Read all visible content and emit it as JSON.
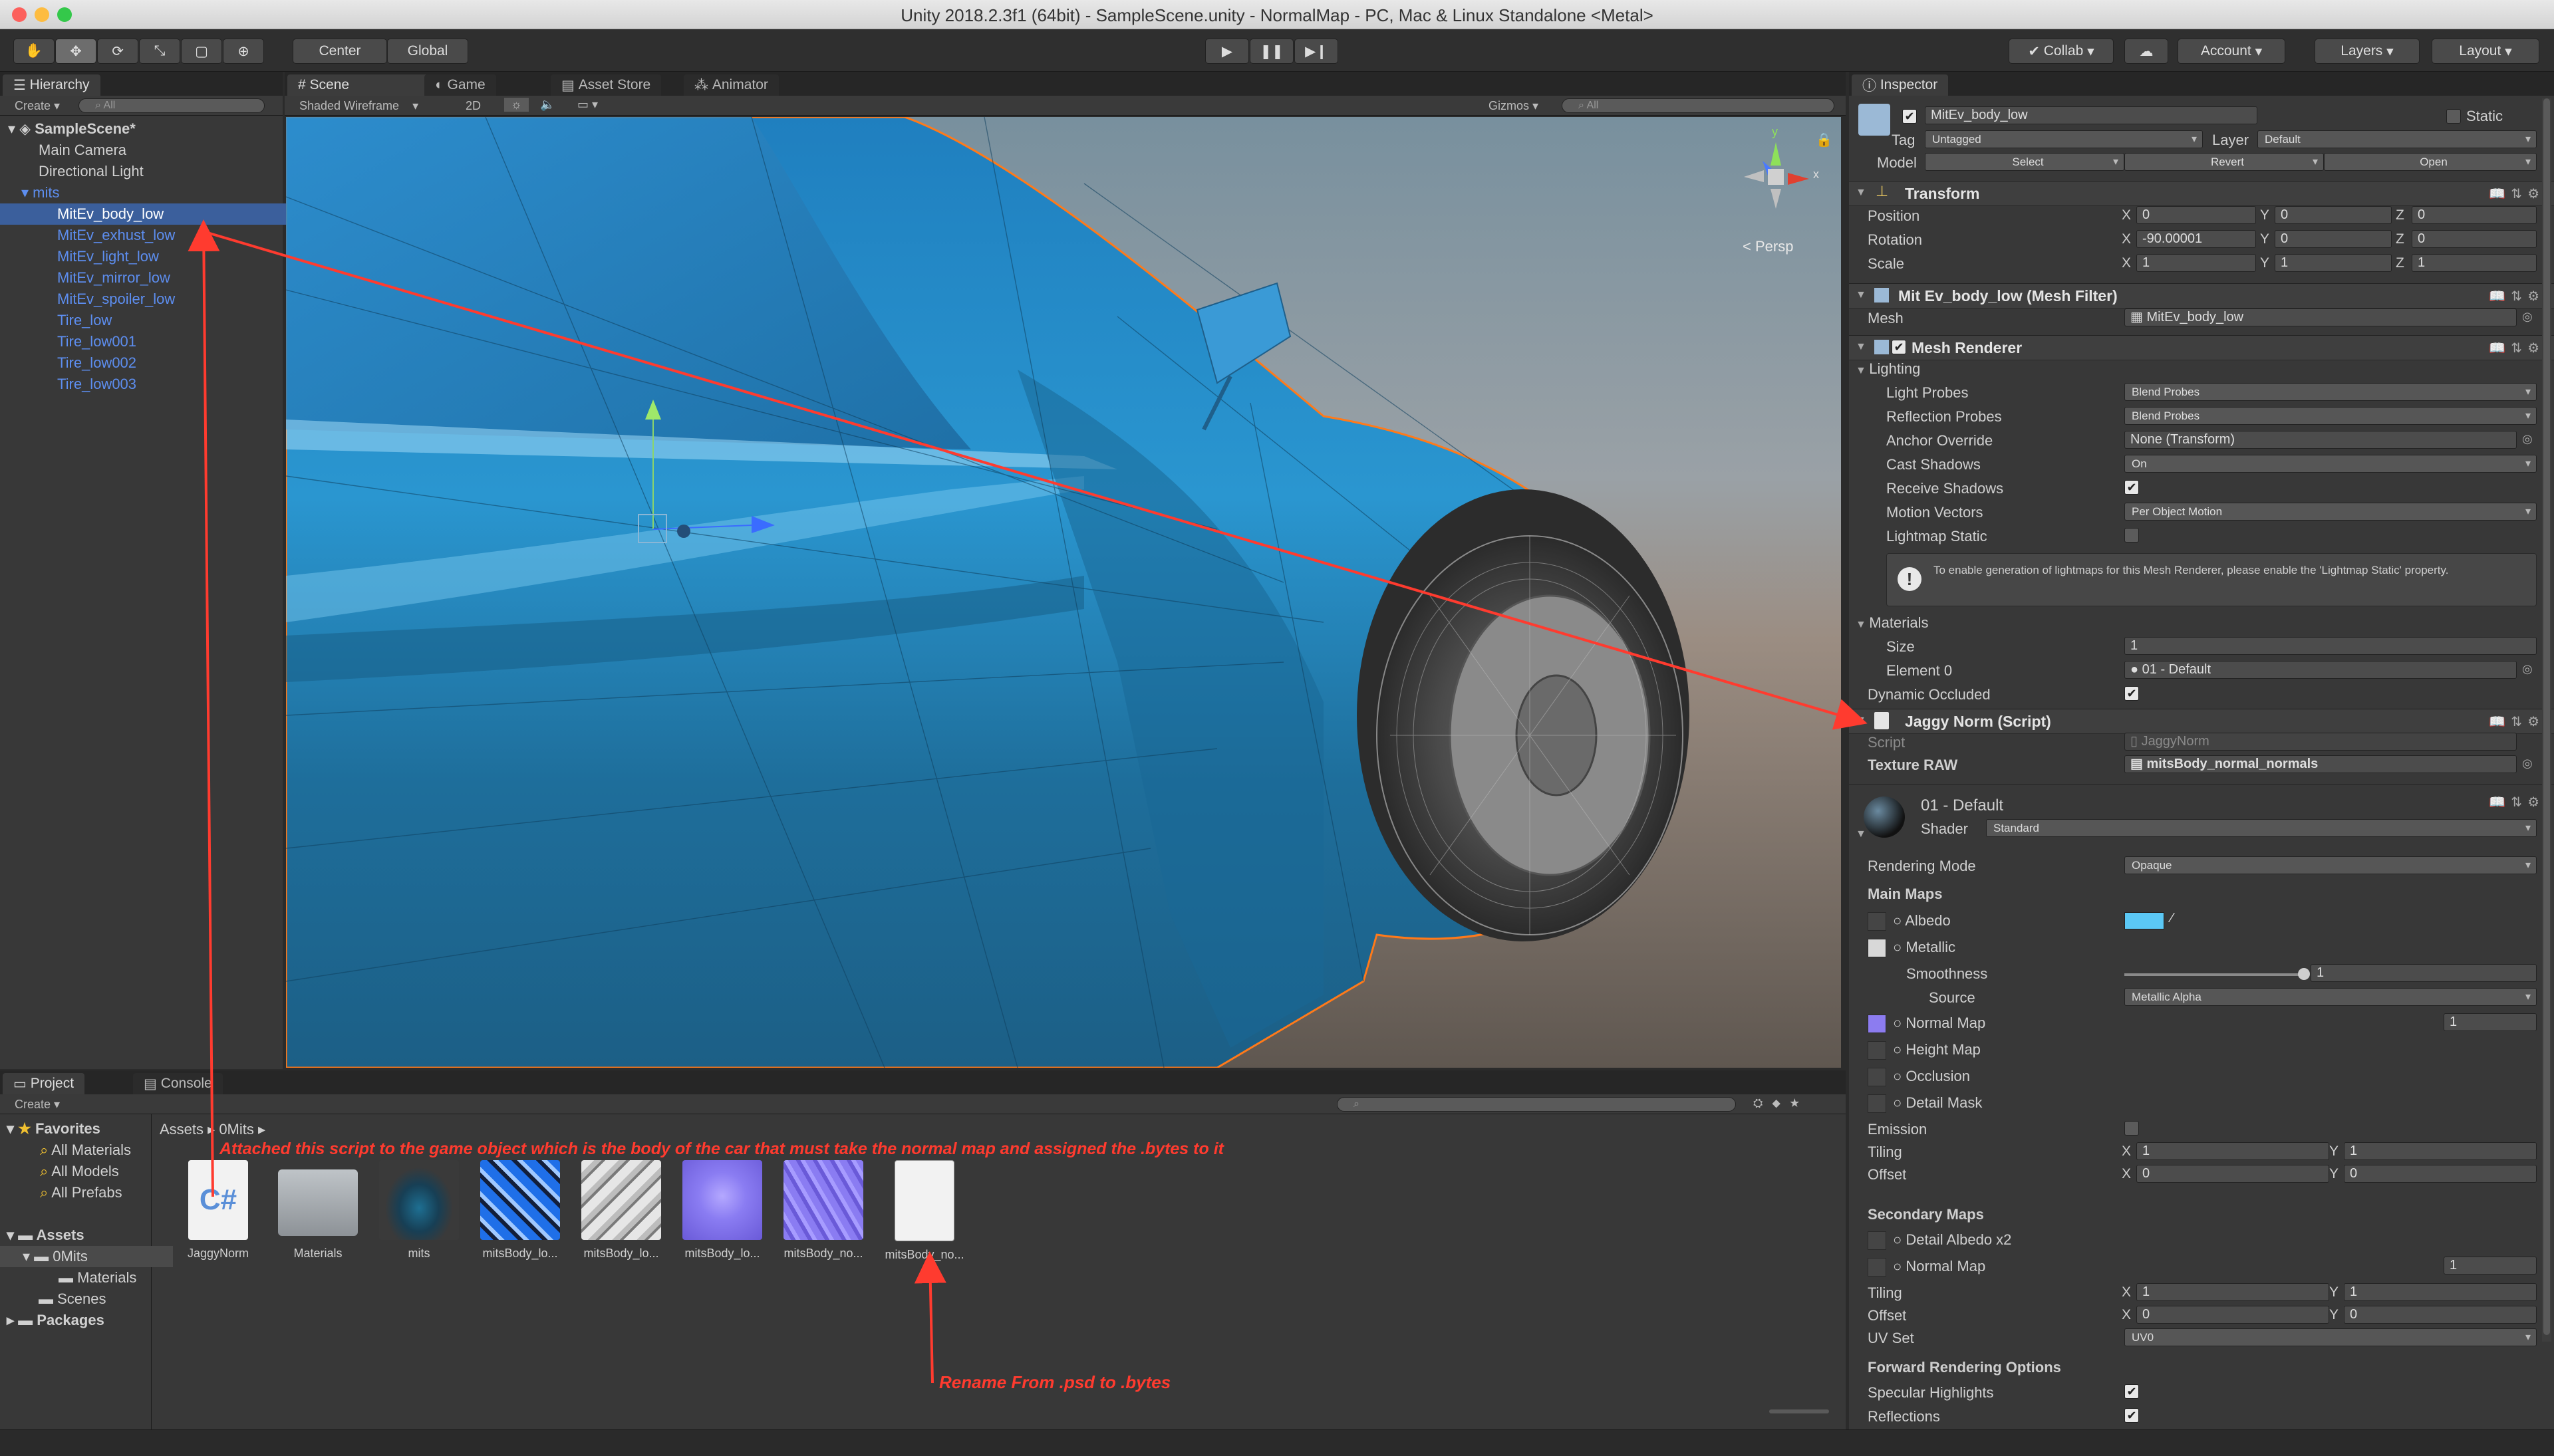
{
  "window": {
    "title": "Unity 2018.2.3f1 (64bit) - SampleScene.unity - NormalMap - PC, Mac & Linux Standalone <Metal>"
  },
  "toolbar": {
    "center": "Center",
    "global": "Global",
    "collab": "Collab",
    "account": "Account",
    "layers": "Layers",
    "layout": "Layout"
  },
  "hierarchy": {
    "tab": "Hierarchy",
    "create": "Create",
    "search_placeholder": "All",
    "items": [
      "SampleScene*",
      "Main Camera",
      "Directional Light",
      "mits",
      "MitEv_body_low",
      "MitEv_exhust_low",
      "MitEv_light_low",
      "MitEv_mirror_low",
      "MitEv_spoiler_low",
      "Tire_low",
      "Tire_low001",
      "Tire_low002",
      "Tire_low003"
    ]
  },
  "scene": {
    "tabs": [
      "Scene",
      "Game",
      "Asset Store",
      "Animator"
    ],
    "shading": "Shaded Wireframe",
    "mode2d": "2D",
    "gizmos": "Gizmos",
    "search_placeholder": "All",
    "persp": "Persp",
    "gizmo_axes": {
      "y": "y",
      "x": "x"
    }
  },
  "inspector": {
    "tab": "Inspector",
    "object_name": "MitEv_body_low",
    "static": "Static",
    "tag_label": "Tag",
    "tag": "Untagged",
    "layer_label": "Layer",
    "layer": "Default",
    "model_label": "Model",
    "model_select": "Select",
    "model_revert": "Revert",
    "model_open": "Open",
    "transform": {
      "title": "Transform",
      "position": "Position",
      "rotation": "Rotation",
      "scale": "Scale",
      "pos": [
        "0",
        "0",
        "0"
      ],
      "rot": [
        "-90.00001",
        "0",
        "0"
      ],
      "scl": [
        "1",
        "1",
        "1"
      ]
    },
    "mesh_filter": {
      "title": "Mit Ev_body_low (Mesh Filter)",
      "mesh_label": "Mesh",
      "mesh": "MitEv_body_low"
    },
    "mesh_renderer": {
      "title": "Mesh Renderer",
      "lighting": "Lighting",
      "light_probes": "Light Probes",
      "light_probes_val": "Blend Probes",
      "reflection_probes": "Reflection Probes",
      "reflection_probes_val": "Blend Probes",
      "anchor_override": "Anchor Override",
      "anchor_override_val": "None (Transform)",
      "cast_shadows": "Cast Shadows",
      "cast_shadows_val": "On",
      "receive_shadows": "Receive Shadows",
      "motion_vectors": "Motion Vectors",
      "motion_vectors_val": "Per Object Motion",
      "lightmap_static": "Lightmap Static",
      "info": "To enable generation of lightmaps for this Mesh Renderer, please enable the 'Lightmap Static' property.",
      "materials": "Materials",
      "size": "Size",
      "size_val": "1",
      "element0": "Element 0",
      "element0_val": "01 - Default",
      "dynamic_occluded": "Dynamic Occluded"
    },
    "script": {
      "title": "Jaggy Norm (Script)",
      "script_label": "Script",
      "script_val": "JaggyNorm",
      "texture_raw": "Texture RAW",
      "texture_raw_val": "mitsBody_normal_normals"
    },
    "material": {
      "name": "01 - Default",
      "shader_label": "Shader",
      "shader": "Standard",
      "rendering_mode": "Rendering Mode",
      "rendering_mode_val": "Opaque",
      "main_maps": "Main Maps",
      "albedo": "Albedo",
      "metallic": "Metallic",
      "smoothness": "Smoothness",
      "smoothness_val": "1",
      "smoothness_level": 1,
      "source": "Source",
      "source_val": "Metallic Alpha",
      "normal_map": "Normal Map",
      "normal_val": "1",
      "height_map": "Height Map",
      "occlusion": "Occlusion",
      "detail_mask": "Detail Mask",
      "emission": "Emission",
      "tiling": "Tiling",
      "offset": "Offset",
      "tiling_x": "1",
      "tiling_y": "1",
      "offset_x": "0",
      "offset_y": "0",
      "secondary_maps": "Secondary Maps",
      "detail_albedo": "Detail Albedo x2",
      "normal_map2": "Normal Map",
      "normal2_val": "1",
      "tiling2_x": "1",
      "tiling2_y": "1",
      "offset2_x": "0",
      "offset2_y": "0",
      "uv_set": "UV Set",
      "uv_set_val": "UV0",
      "forward_options": "Forward Rendering Options",
      "specular_highlights": "Specular Highlights",
      "reflections": "Reflections",
      "albedo_color": "#5bc8f5"
    }
  },
  "project": {
    "tabs": [
      "Project",
      "Console"
    ],
    "create": "Create",
    "favorites": "Favorites",
    "fav_items": [
      "All Materials",
      "All Models",
      "All Prefabs"
    ],
    "assets": "Assets",
    "asset_tree": [
      "0Mits",
      "Materials",
      "Scenes"
    ],
    "packages": "Packages",
    "breadcrumb": [
      "Assets",
      "0Mits"
    ],
    "files": [
      "JaggyNorm",
      "Materials",
      "mits",
      "mitsBody_lo...",
      "mitsBody_lo...",
      "mitsBody_lo...",
      "mitsBody_no...",
      "mitsBody_no..."
    ],
    "cs_glyph": "C#"
  },
  "annotations": {
    "top": "Attached this script to the game object which is the body of the car that must take the normal map and assigned the .bytes to it",
    "bottom": "Rename From .psd to .bytes"
  },
  "colors": {
    "accent_selection": "#3b5f9c",
    "annotation": "#ff3b2f",
    "car_body": "#2e8fc9"
  }
}
